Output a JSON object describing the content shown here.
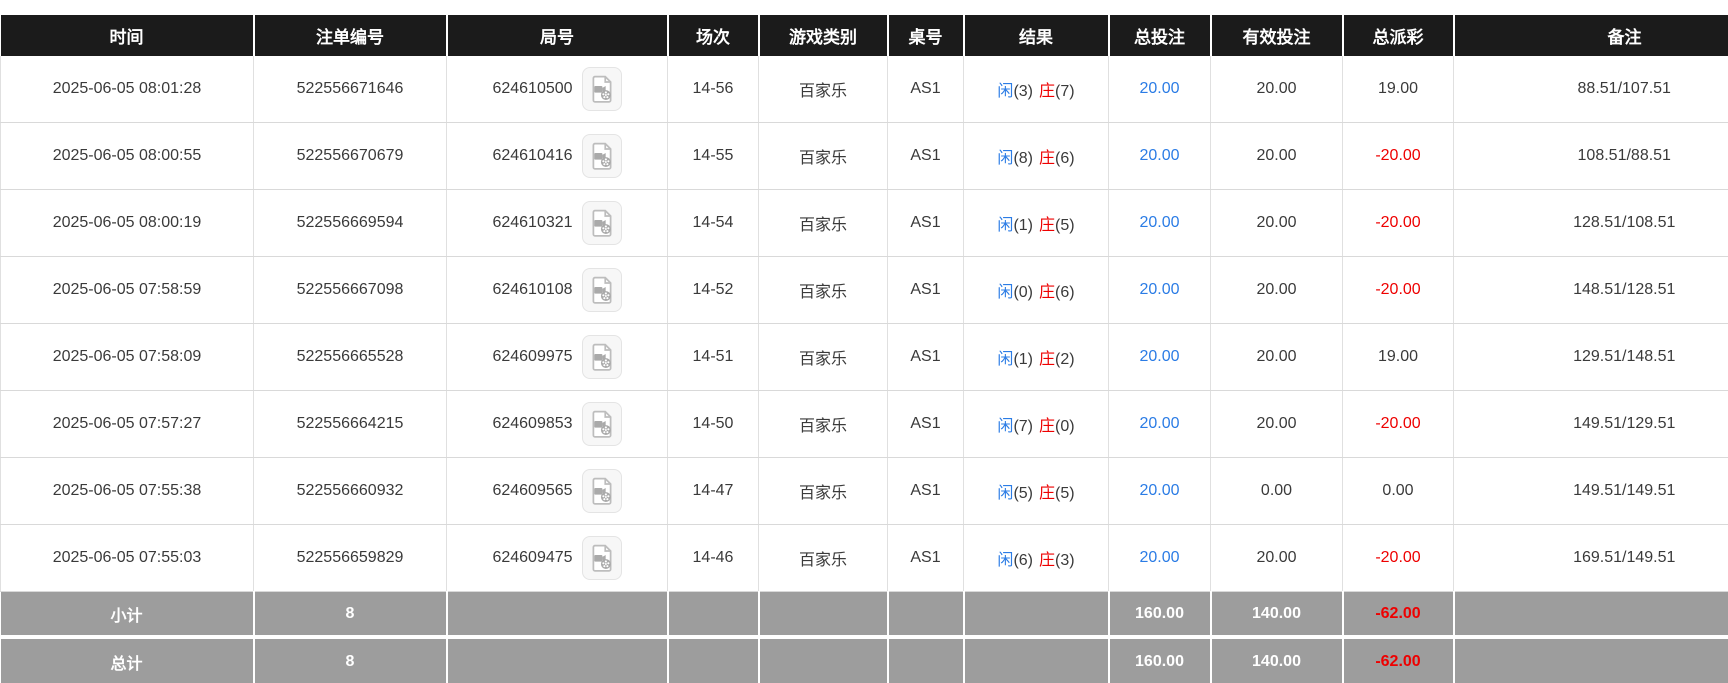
{
  "table": {
    "columns": [
      {
        "label": "时间"
      },
      {
        "label": "注单编号"
      },
      {
        "label": "局号"
      },
      {
        "label": "场次"
      },
      {
        "label": "游戏类别"
      },
      {
        "label": "桌号"
      },
      {
        "label": "结果"
      },
      {
        "label": "总投注"
      },
      {
        "label": "有效投注"
      },
      {
        "label": "总派彩"
      },
      {
        "label": "备注"
      }
    ],
    "icons": {
      "video_icon": "video-file"
    },
    "colors": {
      "header_bg": "#1b1b1b",
      "footer_bg": "#9d9d9d",
      "accent_blue": "#2b7ce5",
      "accent_red": "#ee0000"
    },
    "rows": [
      {
        "time": "2025-06-05 08:01:28",
        "bet_id": "522556671646",
        "round": "624610500",
        "session": "14-56",
        "game_type": "百家乐",
        "table_no": "AS1",
        "player": "闲",
        "player_num": "(3)",
        "banker": "庄",
        "banker_num": "(7)",
        "total_bet": "20.00",
        "valid_bet": "20.00",
        "total_payout": "19.00",
        "remark": "88.51/107.51"
      },
      {
        "time": "2025-06-05 08:00:55",
        "bet_id": "522556670679",
        "round": "624610416",
        "session": "14-55",
        "game_type": "百家乐",
        "table_no": "AS1",
        "player": "闲",
        "player_num": "(8)",
        "banker": "庄",
        "banker_num": "(6)",
        "total_bet": "20.00",
        "valid_bet": "20.00",
        "total_payout": "-20.00",
        "remark": "108.51/88.51"
      },
      {
        "time": "2025-06-05 08:00:19",
        "bet_id": "522556669594",
        "round": "624610321",
        "session": "14-54",
        "game_type": "百家乐",
        "table_no": "AS1",
        "player": "闲",
        "player_num": "(1)",
        "banker": "庄",
        "banker_num": "(5)",
        "total_bet": "20.00",
        "valid_bet": "20.00",
        "total_payout": "-20.00",
        "remark": "128.51/108.51"
      },
      {
        "time": "2025-06-05 07:58:59",
        "bet_id": "522556667098",
        "round": "624610108",
        "session": "14-52",
        "game_type": "百家乐",
        "table_no": "AS1",
        "player": "闲",
        "player_num": "(0)",
        "banker": "庄",
        "banker_num": "(6)",
        "total_bet": "20.00",
        "valid_bet": "20.00",
        "total_payout": "-20.00",
        "remark": "148.51/128.51"
      },
      {
        "time": "2025-06-05 07:58:09",
        "bet_id": "522556665528",
        "round": "624609975",
        "session": "14-51",
        "game_type": "百家乐",
        "table_no": "AS1",
        "player": "闲",
        "player_num": "(1)",
        "banker": "庄",
        "banker_num": "(2)",
        "total_bet": "20.00",
        "valid_bet": "20.00",
        "total_payout": "19.00",
        "remark": "129.51/148.51"
      },
      {
        "time": "2025-06-05 07:57:27",
        "bet_id": "522556664215",
        "round": "624609853",
        "session": "14-50",
        "game_type": "百家乐",
        "table_no": "AS1",
        "player": "闲",
        "player_num": "(7)",
        "banker": "庄",
        "banker_num": "(0)",
        "total_bet": "20.00",
        "valid_bet": "20.00",
        "total_payout": "-20.00",
        "remark": "149.51/129.51"
      },
      {
        "time": "2025-06-05 07:55:38",
        "bet_id": "522556660932",
        "round": "624609565",
        "session": "14-47",
        "game_type": "百家乐",
        "table_no": "AS1",
        "player": "闲",
        "player_num": "(5)",
        "banker": "庄",
        "banker_num": "(5)",
        "total_bet": "20.00",
        "valid_bet": "0.00",
        "total_payout": "0.00",
        "remark": "149.51/149.51"
      },
      {
        "time": "2025-06-05 07:55:03",
        "bet_id": "522556659829",
        "round": "624609475",
        "session": "14-46",
        "game_type": "百家乐",
        "table_no": "AS1",
        "player": "闲",
        "player_num": "(6)",
        "banker": "庄",
        "banker_num": "(3)",
        "total_bet": "20.00",
        "valid_bet": "20.00",
        "total_payout": "-20.00",
        "remark": "169.51/149.51"
      }
    ],
    "footer": [
      {
        "label": "小计",
        "count": "8",
        "total_bet": "160.00",
        "valid_bet": "140.00",
        "total_payout": "-62.00"
      },
      {
        "label": "总计",
        "count": "8",
        "total_bet": "160.00",
        "valid_bet": "140.00",
        "total_payout": "-62.00"
      }
    ]
  }
}
